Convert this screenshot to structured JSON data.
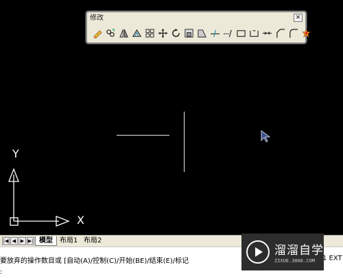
{
  "toolbar": {
    "title": "修改",
    "close": "✕",
    "tools": [
      "erase-icon",
      "copy-icon",
      "mirror-icon",
      "offset-icon",
      "array-icon",
      "move-icon",
      "rotate-icon",
      "scale-icon",
      "stretch-icon",
      "trim-icon",
      "extend-icon",
      "break-at-point-icon",
      "break-icon",
      "join-icon",
      "chamfer-icon",
      "fillet-icon",
      "explode-icon"
    ]
  },
  "ucs": {
    "x_label": "X",
    "y_label": "Y"
  },
  "tabs": {
    "nav": [
      "|◀",
      "◀",
      "▶",
      "▶|"
    ],
    "items": [
      "模型",
      "布局1",
      "布局2"
    ]
  },
  "command": {
    "line1": "要放弃的操作数目或 [自动(A)/控制(C)/开始(BE)/结束(E)/标记",
    "line1_end": "1 EXT",
    "line2": ":"
  },
  "watermark": {
    "brand": "溜溜自学",
    "url": "ZIXUE.3066.COM"
  }
}
